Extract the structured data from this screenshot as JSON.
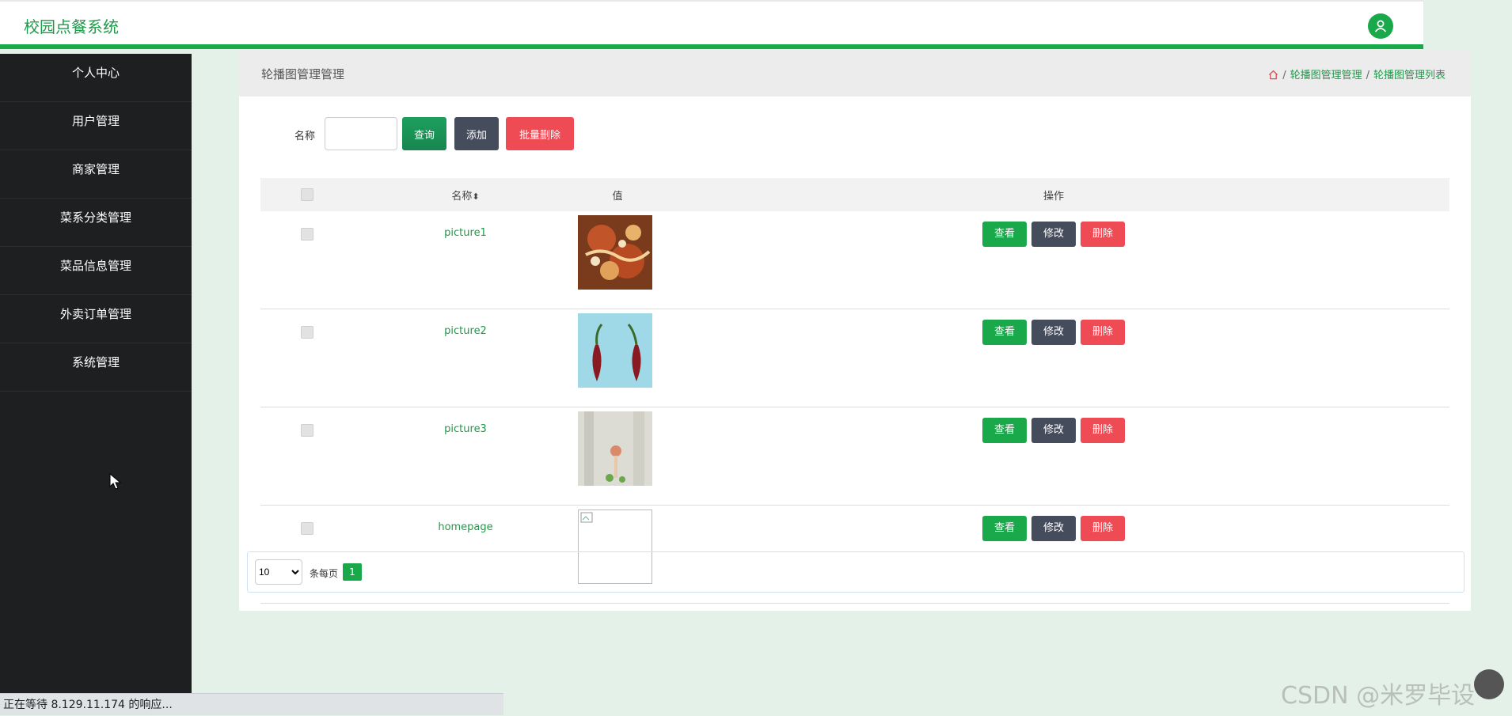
{
  "app": {
    "title": "校园点餐系统"
  },
  "sidebar": {
    "items": [
      {
        "label": "个人中心"
      },
      {
        "label": "用户管理"
      },
      {
        "label": "商家管理"
      },
      {
        "label": "菜系分类管理"
      },
      {
        "label": "菜品信息管理"
      },
      {
        "label": "外卖订单管理"
      },
      {
        "label": "系统管理"
      }
    ]
  },
  "page": {
    "title": "轮播图管理管理",
    "breadcrumb": [
      "轮播图管理管理",
      "轮播图管理列表"
    ]
  },
  "filter": {
    "name_label": "名称",
    "name_value": "",
    "search_label": "查询",
    "add_label": "添加",
    "batch_delete_label": "批量删除"
  },
  "table": {
    "headers": {
      "name": "名称",
      "sort_icon": "⬍",
      "value": "值",
      "actions": "操作"
    },
    "rows": [
      {
        "name": "picture1",
        "image": "seafood-icon"
      },
      {
        "name": "picture2",
        "image": "chili-icon"
      },
      {
        "name": "picture3",
        "image": "dessert-icon"
      },
      {
        "name": "homepage",
        "image": "broken-image-icon"
      }
    ],
    "action_labels": {
      "view": "查看",
      "edit": "修改",
      "delete": "删除"
    }
  },
  "pagination": {
    "page_size": "10",
    "page_size_options": [
      "10"
    ],
    "per_page_label": "条每页",
    "current_page": "1"
  },
  "status_bar": {
    "text": "正在等待 8.129.11.174 的响应..."
  },
  "watermark": {
    "text": "CSDN @米罗毕设"
  },
  "colors": {
    "accent": "#19a84a",
    "sidebar": "#1e1f21",
    "danger": "#ef4b55",
    "dark_button": "#454c5c"
  }
}
